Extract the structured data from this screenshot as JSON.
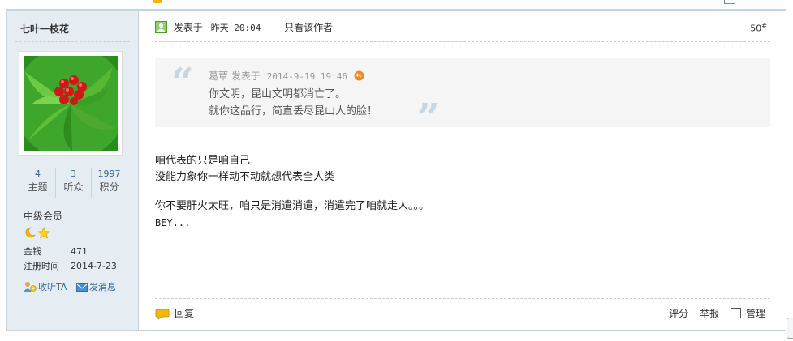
{
  "author": {
    "name": "七叶一枝花",
    "stats": [
      {
        "value": "4",
        "label": "主题"
      },
      {
        "value": "3",
        "label": "听众"
      },
      {
        "value": "1997",
        "label": "积分"
      }
    ],
    "level": "中级会员",
    "money_label": "金钱",
    "money_value": "471",
    "register_label": "注册时间",
    "register_value": "2014-7-23",
    "follow_label": "收听TA",
    "message_label": "发消息"
  },
  "post": {
    "published_label": "发表于",
    "published_time": "昨天 20:04",
    "only_author": "只看该作者",
    "floor": "50",
    "floor_sup": "#",
    "quote": {
      "author": "葛覃",
      "published_label": "发表于",
      "time": "2014-9-19 19:46",
      "lines": [
        "你文明，昆山文明都消亡了。",
        "就你这品行，简直丢尽昆山人的脸！"
      ]
    },
    "body": {
      "line1": "咱代表的只是咱自己",
      "line2": "没能力象你一样动不动就想代表全人类",
      "line3": "你不要肝火太旺，咱只是消遣消遣，消遣完了咱就走人。。。",
      "line4": "BEY..."
    },
    "footer": {
      "reply": "回复",
      "rate": "评分",
      "report": "举报",
      "manage": "管理"
    }
  }
}
